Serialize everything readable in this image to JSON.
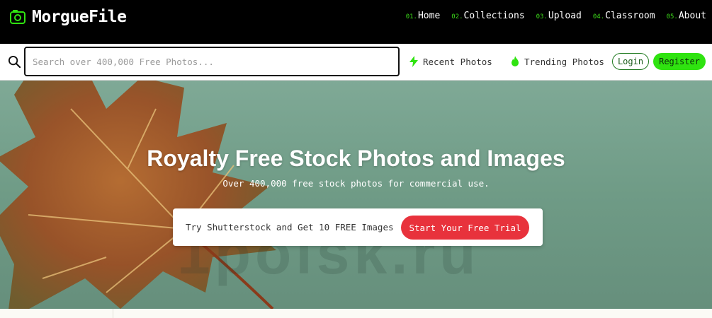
{
  "brand": {
    "name": "MorgueFile"
  },
  "nav": [
    {
      "num": "01.",
      "label": "Home"
    },
    {
      "num": "02.",
      "label": "Collections"
    },
    {
      "num": "03.",
      "label": "Upload"
    },
    {
      "num": "04.",
      "label": "Classroom"
    },
    {
      "num": "05.",
      "label": "About"
    }
  ],
  "search": {
    "placeholder": "Search over 400,000 Free Photos...",
    "value": ""
  },
  "quicklinks": {
    "recent": "Recent Photos",
    "trending": "Trending Photos"
  },
  "auth": {
    "login": "Login",
    "register": "Register"
  },
  "hero": {
    "title": "Royalty Free Stock Photos and Images",
    "subtitle": "Over 400,000 free stock photos for commercial use.",
    "promo_text": "Try Shutterstock and Get 10 FREE Images",
    "promo_button": "Start Your Free Trial",
    "watermark": "1poisk.ru"
  },
  "colors": {
    "accent_green": "#2fe310",
    "nav_number_green": "#3ddc1a",
    "promo_red": "#e8323c",
    "topbar_black": "#000000"
  },
  "icons": [
    "camera-logo-icon",
    "search-icon",
    "lightning-icon",
    "fire-icon"
  ]
}
